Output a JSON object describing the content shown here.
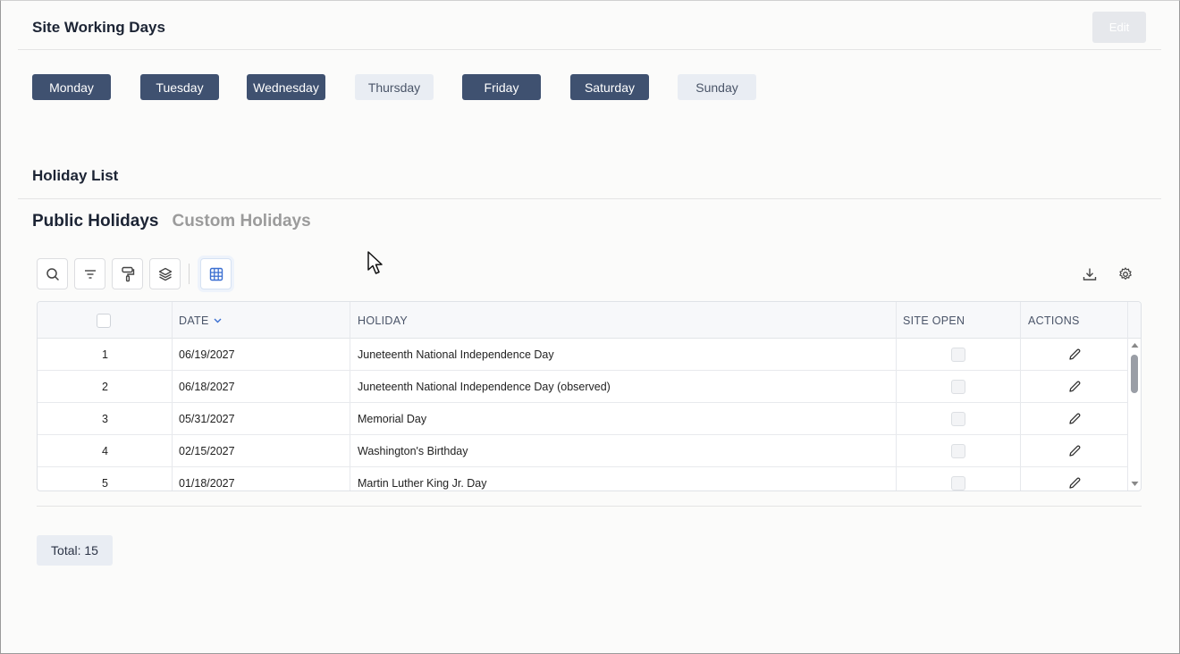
{
  "working_days": {
    "title": "Site Working Days",
    "edit_label": "Edit",
    "days": [
      {
        "label": "Monday",
        "active": true
      },
      {
        "label": "Tuesday",
        "active": true
      },
      {
        "label": "Wednesday",
        "active": true
      },
      {
        "label": "Thursday",
        "active": false
      },
      {
        "label": "Friday",
        "active": true
      },
      {
        "label": "Saturday",
        "active": true
      },
      {
        "label": "Sunday",
        "active": false
      }
    ]
  },
  "holiday_list": {
    "title": "Holiday List",
    "tabs": [
      "Public Holidays",
      "Custom Holidays"
    ],
    "active_tab": "Public Holidays",
    "toolbar_icons": [
      "search-icon",
      "filter-icon",
      "paint-roller-icon",
      "layers-icon",
      "grid-icon"
    ],
    "right_icons": [
      "download-icon",
      "settings-icon"
    ],
    "columns": {
      "date": "DATE",
      "holiday": "HOLIDAY",
      "site_open": "SITE OPEN",
      "actions": "ACTIONS"
    },
    "sort_indicator": "chevron-down-icon",
    "rows": [
      {
        "index": "1",
        "date": "06/19/2027",
        "holiday": "Juneteenth National Independence Day",
        "site_open": false
      },
      {
        "index": "2",
        "date": "06/18/2027",
        "holiday": "Juneteenth National Independence Day (observed)",
        "site_open": false
      },
      {
        "index": "3",
        "date": "05/31/2027",
        "holiday": "Memorial Day",
        "site_open": false
      },
      {
        "index": "4",
        "date": "02/15/2027",
        "holiday": "Washington's Birthday",
        "site_open": false
      },
      {
        "index": "5",
        "date": "01/18/2027",
        "holiday": "Martin Luther King Jr. Day",
        "site_open": false
      }
    ],
    "total_label": "Total: 15"
  },
  "colors": {
    "active_day": "#3f5170",
    "inactive_day": "#e9edf3",
    "accent": "#3b6fd1"
  }
}
